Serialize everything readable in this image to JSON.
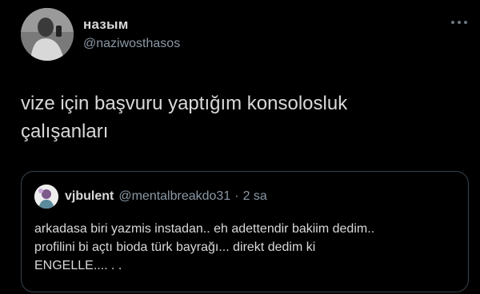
{
  "tweet": {
    "author": {
      "display_name": "назым",
      "handle": "@naziwosthasos",
      "avatar_icon": "profile-photo"
    },
    "more_icon": "more-horizontal-icon",
    "text": "vize için başvuru yaptığım konsolosluk\nçalışanları"
  },
  "quoted_tweet": {
    "author": {
      "display_name": "vjbulent",
      "handle": "@mentalbreakdo31",
      "avatar_icon": "profile-photo"
    },
    "separator": "·",
    "time": "2 sa",
    "text": "arkadasa biri yazmis instadan.. eh adettendir bakiim dedim..\nprofilini bi açtı bioda türk bayrağı... direkt dedim ki\nENGELLE.... . ."
  },
  "colors": {
    "background": "#000000",
    "text": "#d9d9d9",
    "secondary_text": "#8b98a5",
    "border": "#38444d"
  }
}
